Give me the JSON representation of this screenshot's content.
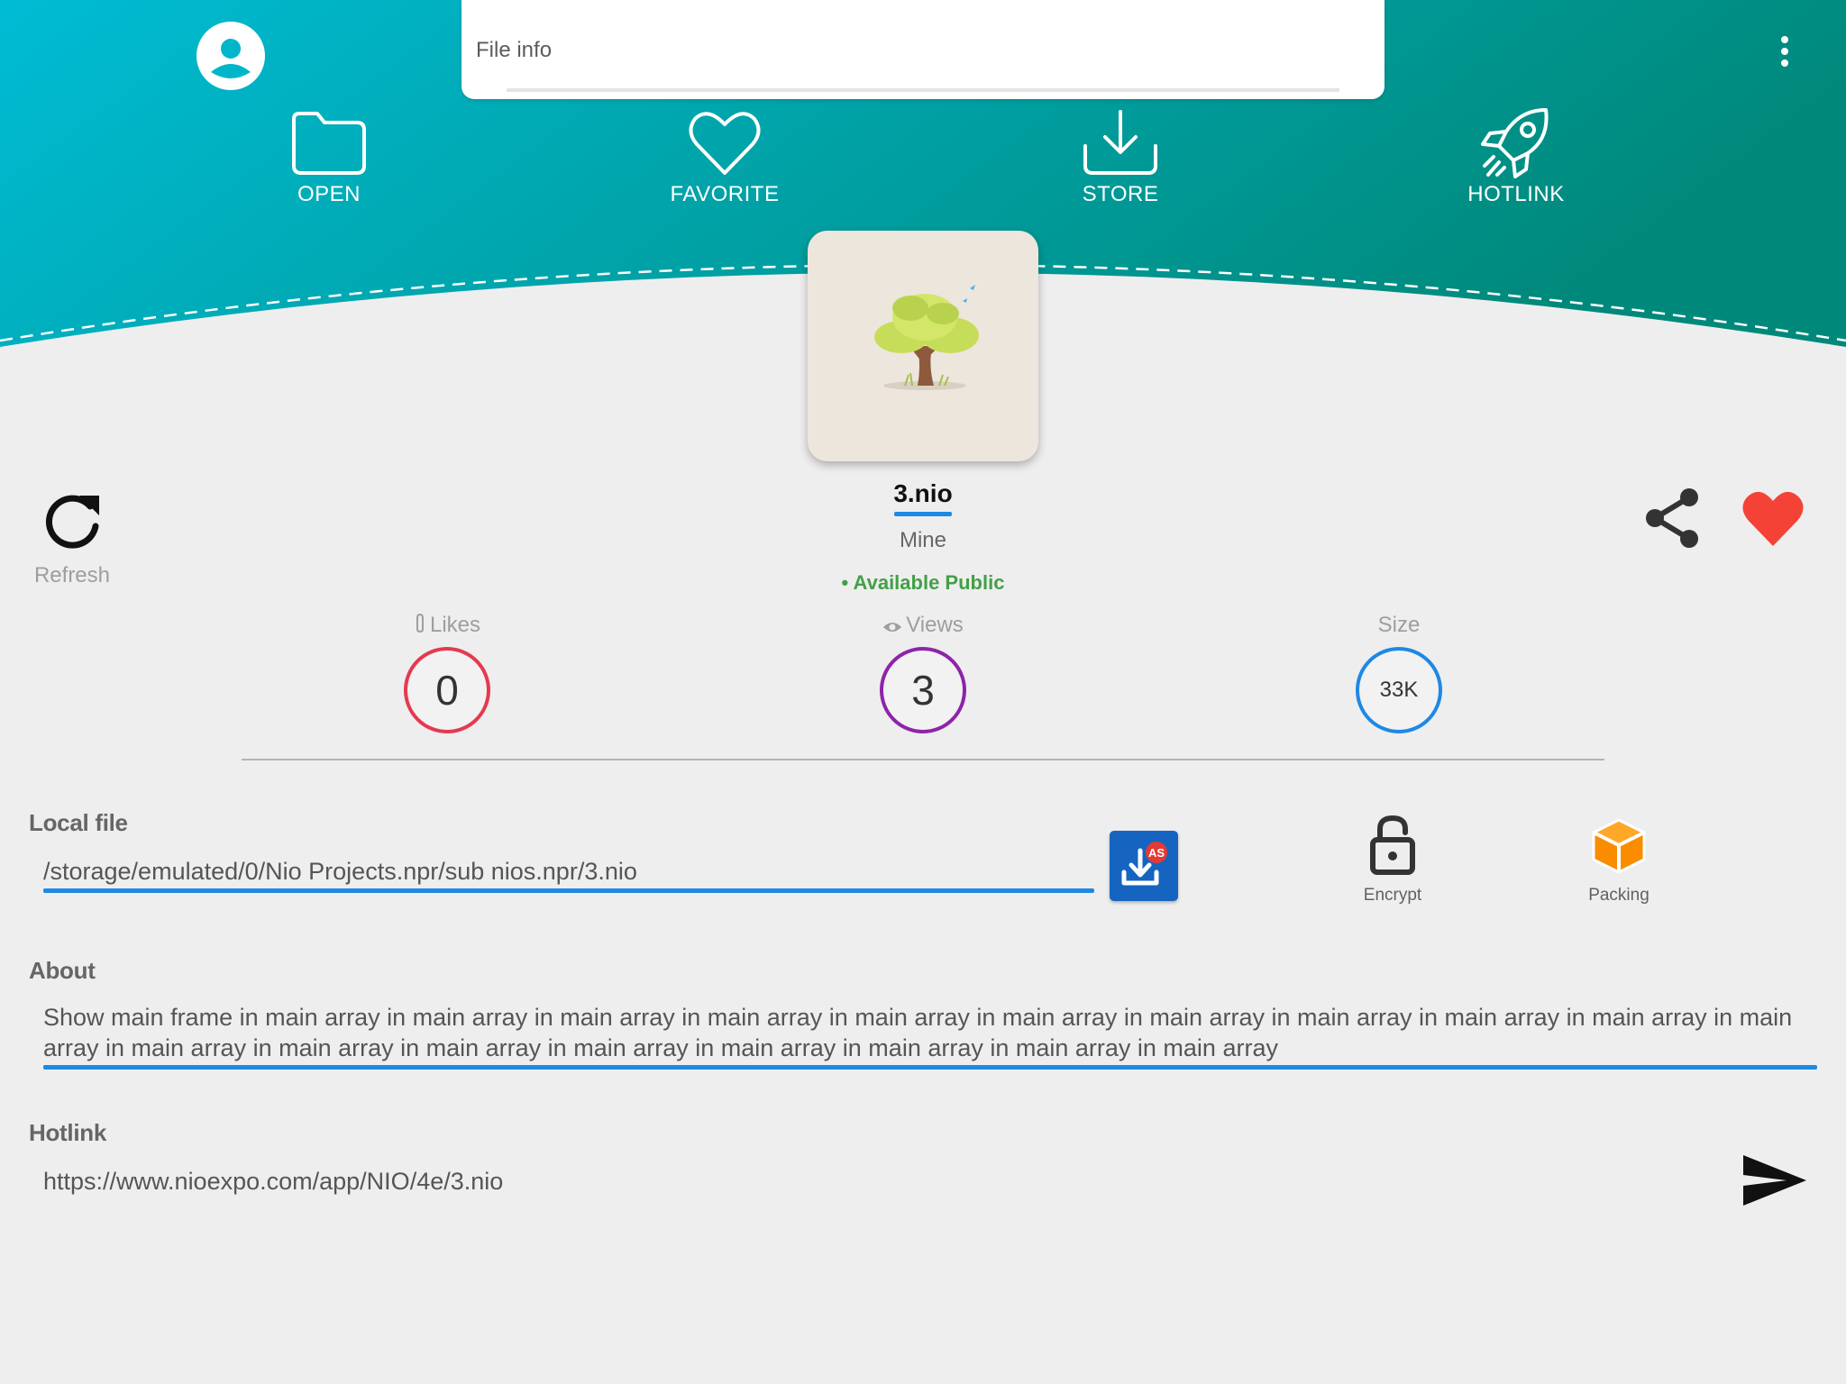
{
  "header": {
    "title_placeholder": "File info",
    "gradient_start": "#00bcd4",
    "gradient_end": "#00897b",
    "nav": [
      {
        "label": "OPEN",
        "icon": "folder-icon"
      },
      {
        "label": "FAVORITE",
        "icon": "heart-outline-icon"
      },
      {
        "label": "STORE",
        "icon": "download-icon"
      },
      {
        "label": "HOTLINK",
        "icon": "rocket-icon"
      }
    ]
  },
  "file": {
    "name": "3.nio",
    "owner": "Mine",
    "availability": "• Available Public",
    "thumbnail": "tree-image"
  },
  "actions": {
    "refresh_label": "Refresh",
    "share_icon": "share-icon",
    "favorite_icon": "heart-filled-icon",
    "favorite_color": "#f44336"
  },
  "stats": {
    "likes": {
      "label": "Likes",
      "value": "0",
      "color": "#e53950"
    },
    "views": {
      "label": "Views",
      "value": "3",
      "color": "#8e24aa"
    },
    "size": {
      "label": "Size",
      "value": "33K",
      "color": "#1e88e5"
    }
  },
  "local_file": {
    "title": "Local file",
    "path": "/storage/emulated/0/Nio Projects.npr/sub nios.npr/3.nio",
    "as_badge": "AS",
    "encrypt_label": "Encrypt",
    "packing_label": "Packing"
  },
  "about": {
    "title": "About",
    "text": "Show main frame in main array in main array in main array in main array in main array in main array in main array in main array in main array in main array in main array in main array in main array in main array in main array in main array in main array in main array in main array"
  },
  "hotlink": {
    "title": "Hotlink",
    "url": "https://www.nioexpo.com/app/NIO/4e/3.nio"
  }
}
